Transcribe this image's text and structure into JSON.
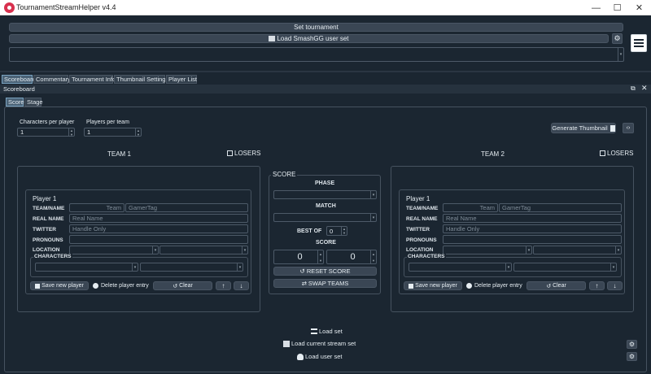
{
  "window": {
    "title": "TournamentStreamHelper v4.4",
    "minimize": "—",
    "maximize": "☐",
    "close": "✕"
  },
  "top": {
    "set_tournament": "Set tournament",
    "load_smashgg": "Load SmashGG user set",
    "url_field": ""
  },
  "main_tabs": [
    "Scoreboard",
    "Commentary",
    "Tournament Info",
    "Thumbnail Settings",
    "Player List"
  ],
  "scoreboard": {
    "title": "Scoreboard",
    "subtabs": [
      "Score",
      "Stage"
    ],
    "characters_per_player": {
      "label": "Characters per player",
      "value": "1"
    },
    "players_per_team": {
      "label": "Players per team",
      "value": "1"
    },
    "generate_thumbnail": "Generate Thumbnail",
    "team1": {
      "title": "TEAM 1",
      "losers": "LOSERS"
    },
    "team2": {
      "title": "TEAM 2",
      "losers": "LOSERS"
    },
    "player_labels": {
      "player": "Player 1",
      "team_name": "TEAM/NAME",
      "team_placeholder": "Team",
      "gamertag_placeholder": "GamerTag",
      "real_name": "REAL NAME",
      "real_name_placeholder": "Real Name",
      "twitter": "TWITTER",
      "twitter_placeholder": "Handle Only",
      "pronouns": "PRONOUNS",
      "location": "LOCATION",
      "characters": "CHARACTERS",
      "save_new_player": "Save new player",
      "delete_player_entry": "Delete player entry",
      "clear": "Clear",
      "up": "↑",
      "down": "↓"
    },
    "score": {
      "title": "SCORE",
      "phase": "PHASE",
      "match": "MATCH",
      "best_of": "BEST OF",
      "best_of_value": "0",
      "score_label": "SCORE",
      "score1": "0",
      "score2": "0",
      "reset_score": "RESET SCORE",
      "swap_teams": "SWAP TEAMS"
    },
    "bottom": {
      "load_set": "Load set",
      "load_current_stream_set": "Load current stream set",
      "load_user_set": "Load user set"
    }
  },
  "colors": {
    "background": "#1b2631",
    "button": "#3a4654",
    "border": "#46525f",
    "active_tab": "#4a6276"
  }
}
